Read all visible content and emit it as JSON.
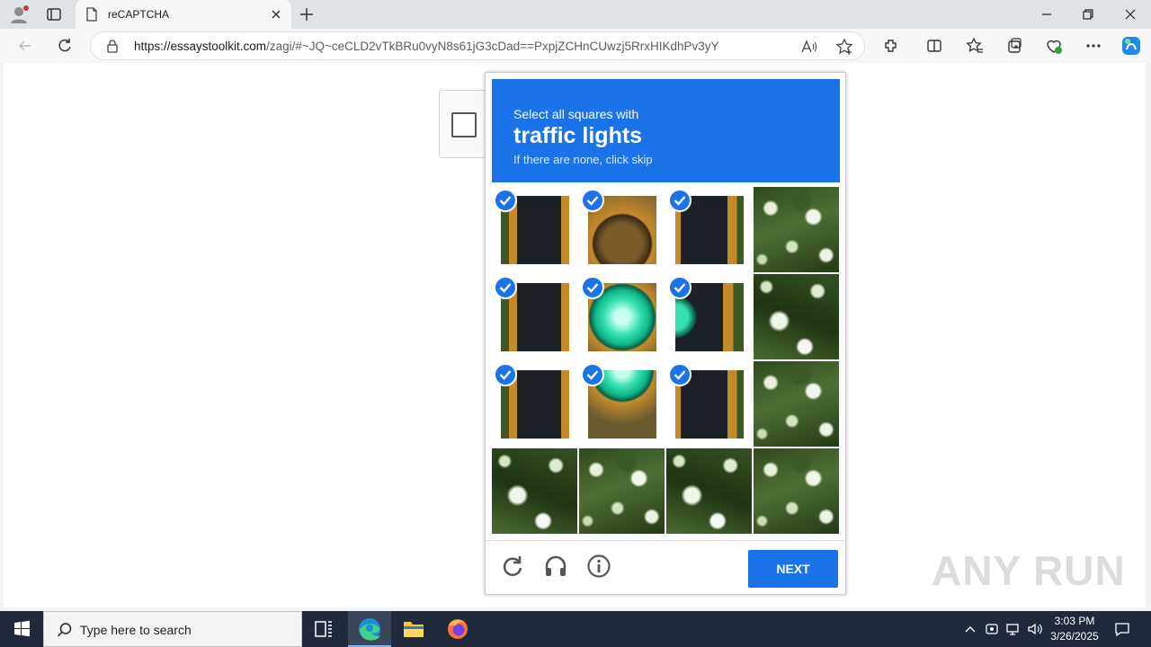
{
  "browser": {
    "tab_title": "reCAPTCHA",
    "url_host": "https://essaystoolkit.com",
    "url_path": "/zagi/#~JQ~ceCLD2vTkBRu0vyN8s61jG3cDad==PxpjZCHnCUwzj5RrxHIKdhPv3yY"
  },
  "captcha": {
    "instruction": "Select all squares with",
    "target": "traffic lights",
    "hint": "If there are none, click skip",
    "next_label": "NEXT",
    "tiles": [
      {
        "row": 0,
        "col": 0,
        "selected": true,
        "img": "housing"
      },
      {
        "row": 0,
        "col": 1,
        "selected": true,
        "img": "lamp-off"
      },
      {
        "row": 0,
        "col": 2,
        "selected": true,
        "img": "housing2"
      },
      {
        "row": 0,
        "col": 3,
        "selected": false,
        "img": "foliage"
      },
      {
        "row": 1,
        "col": 0,
        "selected": true,
        "img": "housing"
      },
      {
        "row": 1,
        "col": 1,
        "selected": true,
        "img": "lamp-on"
      },
      {
        "row": 1,
        "col": 2,
        "selected": true,
        "img": "lamp-side"
      },
      {
        "row": 1,
        "col": 3,
        "selected": false,
        "img": "foliage2"
      },
      {
        "row": 2,
        "col": 0,
        "selected": true,
        "img": "housing"
      },
      {
        "row": 2,
        "col": 1,
        "selected": true,
        "img": "lamp-on2"
      },
      {
        "row": 2,
        "col": 2,
        "selected": true,
        "img": "housing2"
      },
      {
        "row": 2,
        "col": 3,
        "selected": false,
        "img": "foliage"
      },
      {
        "row": 3,
        "col": 0,
        "selected": false,
        "img": "foliage2"
      },
      {
        "row": 3,
        "col": 1,
        "selected": false,
        "img": "foliage"
      },
      {
        "row": 3,
        "col": 2,
        "selected": false,
        "img": "foliage2"
      },
      {
        "row": 3,
        "col": 3,
        "selected": false,
        "img": "foliage"
      }
    ]
  },
  "watermark": "ANY RUN",
  "taskbar": {
    "search_placeholder": "Type here to search",
    "time": "3:03 PM",
    "date": "3/26/2025"
  },
  "colors": {
    "accent": "#1a73e8",
    "taskbar": "#202a3a"
  }
}
